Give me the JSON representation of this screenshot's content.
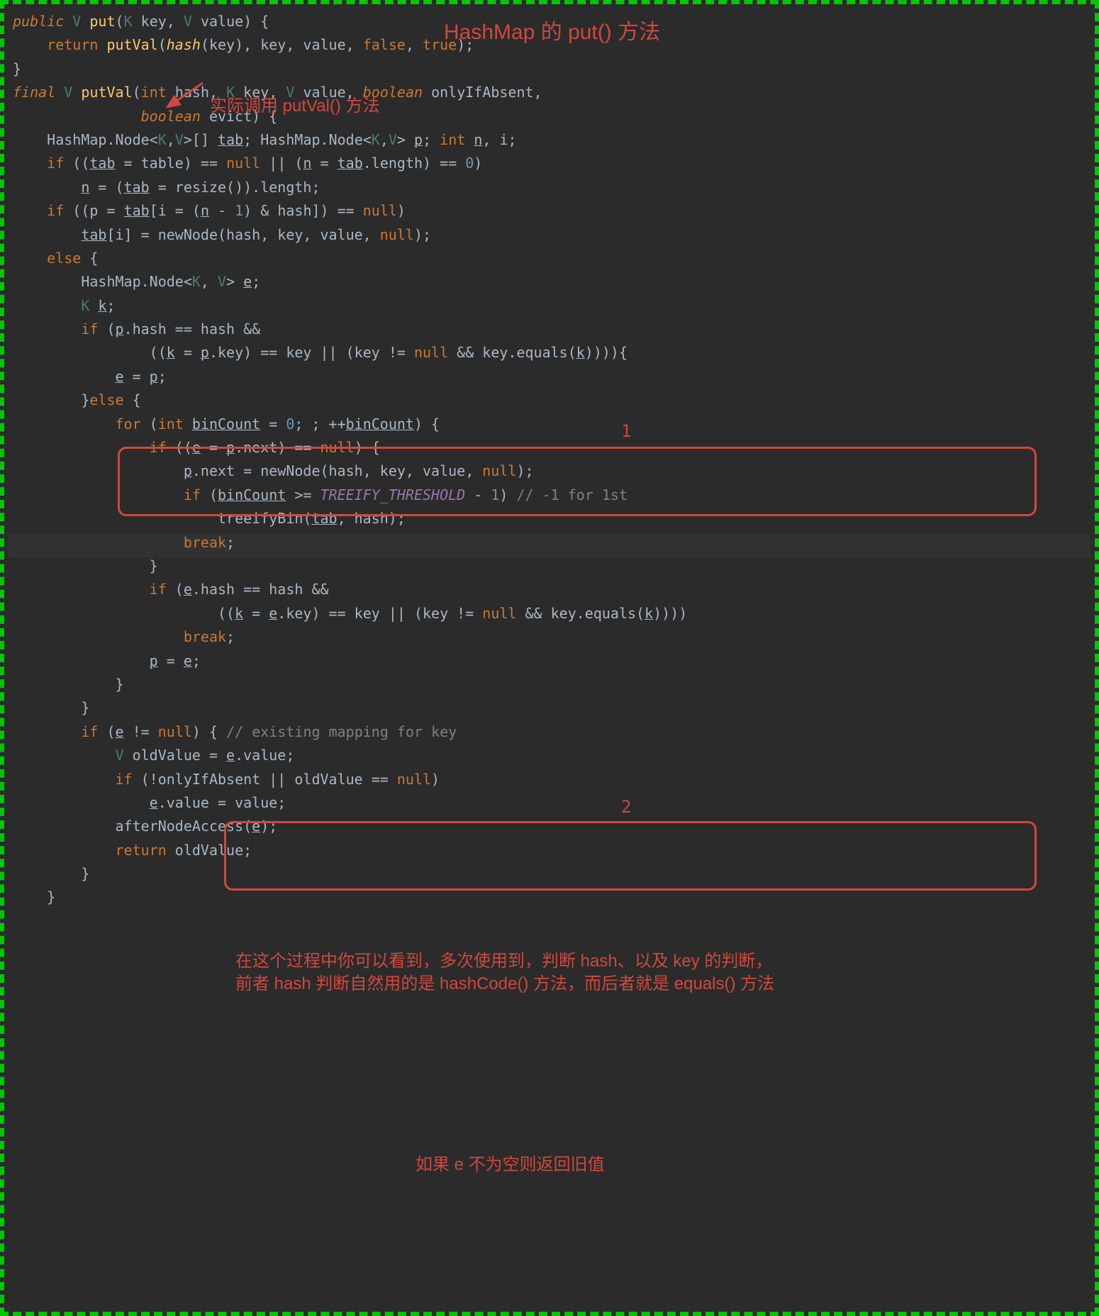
{
  "annotations": {
    "title": "HashMap 的 put() 方法",
    "calls": "实际调用 putVal() 方法",
    "box1_num": "1",
    "box2_num": "2",
    "summary_l1": "在这个过程中你可以看到，多次使用到，判断 hash、以及 key 的判断，",
    "summary_l2": "前者 hash 判断自然用的是 hashCode() 方法，而后者就是 equals() 方法",
    "old_value_note": "如果 e 不为空则返回旧值"
  },
  "code": {
    "l01_public": "public",
    "l01_V": "V",
    "l01_put": "put",
    "l01_K": "K",
    "l01_key": " key, ",
    "l01_Vp": "V",
    "l01_val": " value) {",
    "l02_return": "return",
    "l02_putVal": "putVal",
    "l02_hash": "hash",
    "l02_rest": "(key), key, value, ",
    "l02_false": "false",
    "l02_comma": ", ",
    "l02_true": "true",
    "l02_end": ");",
    "l03": "}",
    "l04_final": "final",
    "l04_V": "V",
    "l04_putVal": "putVal",
    "l04_int": "int",
    "l04_hash": " hash, ",
    "l04_K": "K",
    "l04_key": " key, ",
    "l04_Vp": "V",
    "l04_value": " value, ",
    "l04_boolean": "boolean",
    "l04_only": " onlyIfAbsent,",
    "l05_boolean": "boolean",
    "l05_evict": " evict) {",
    "l06_a": "HashMap.Node<",
    "l06_b": ",",
    "l06_c": ">[] ",
    "l06_tab": "tab",
    "l06_d": "; HashMap.Node<",
    "l06_e": ",",
    "l06_f": "> ",
    "l06_p": "p",
    "l06_g": "; ",
    "l06_int": "int",
    "l06_h": " ",
    "l06_n": "n",
    "l06_i": ", i;",
    "l07_if": "if",
    "l07_a": " ((",
    "l07_tab": "tab",
    "l07_b": " = table) == ",
    "l07_null": "null",
    "l07_c": " || (",
    "l07_n": "n",
    "l07_d": " = ",
    "l07_tab2": "tab",
    "l07_e": ".length) == ",
    "l07_zero": "0",
    "l07_f": ")",
    "l08_n": "n",
    "l08_a": " = (",
    "l08_tab": "tab",
    "l08_b": " = resize()).length;",
    "l09_if": "if",
    "l09_a": " ((p = ",
    "l09_tab": "tab",
    "l09_b": "[i = (",
    "l09_n": "n",
    "l09_c": " - ",
    "l09_one": "1",
    "l09_d": ") & hash]) == ",
    "l09_null": "null",
    "l09_e": ")",
    "l10_tab": "tab",
    "l10_a": "[i] = newNode(hash, key, value, ",
    "l10_null": "null",
    "l10_b": ");",
    "l11_else": "else",
    "l11_a": " {",
    "l12_a": "HashMap.Node<",
    "l12_K": "K",
    "l12_b": ", ",
    "l12_V": "V",
    "l12_c": "> ",
    "l12_e": "e",
    "l12_d": ";",
    "l13_K": "K",
    "l13_sp": " ",
    "l13_k": "k",
    "l13_a": ";",
    "l14_if": "if",
    "l14_a": " (",
    "l14_p": "p",
    "l14_b": ".hash == hash &&",
    "l15_a": "((",
    "l15_k": "k",
    "l15_b": " = ",
    "l15_p": "p",
    "l15_c": ".key) == key || (key != ",
    "l15_null": "null",
    "l15_d": " && key.equals(",
    "l15_k2": "k",
    "l15_e": ")))){",
    "l16_e": "e",
    "l16_a": " = ",
    "l16_p": "p",
    "l16_b": ";",
    "l17": "}",
    "l17_else": "else",
    "l17_a": " {",
    "l18_for": "for",
    "l18_a": " (",
    "l18_int": "int",
    "l18_b": " ",
    "l18_bc": "binCount",
    "l18_c": " = ",
    "l18_zero": "0",
    "l18_d": "; ; ++",
    "l18_bc2": "binCount",
    "l18_e": ") {",
    "l19_if": "if",
    "l19_a": " ((",
    "l19_e": "e",
    "l19_b": " = ",
    "l19_p": "p",
    "l19_c": ".next) == ",
    "l19_null": "null",
    "l19_d": ") {",
    "l20_p": "p",
    "l20_a": ".next = newNode(hash, key, value, ",
    "l20_null": "null",
    "l20_b": ");",
    "l21_if": "if",
    "l21_a": " (",
    "l21_bc": "binCount",
    "l21_b": " >= ",
    "l21_th": "TREEIFY_THRESHOLD",
    "l21_c": " - ",
    "l21_one": "1",
    "l21_d": ") ",
    "l21_cmt": "// -1 for 1st",
    "l22_a": "treeifyBin(",
    "l22_tab": "tab",
    "l22_b": ", hash);",
    "l23_break": "break",
    "l23_a": ";",
    "l24": "}",
    "l25_if": "if",
    "l25_a": " (",
    "l25_e": "e",
    "l25_b": ".hash == hash &&",
    "l26_a": "((",
    "l26_k": "k",
    "l26_b": " = ",
    "l26_e": "e",
    "l26_c": ".key) == key || (key != ",
    "l26_null": "null",
    "l26_d": " && key.equals(",
    "l26_k2": "k",
    "l26_e2": "))))",
    "l27_break": "break",
    "l27_a": ";",
    "l28_p": "p",
    "l28_a": " = ",
    "l28_e": "e",
    "l28_b": ";",
    "l29": "}",
    "l30": "}",
    "l31_if": "if",
    "l31_a": " (",
    "l31_e": "e",
    "l31_b": " != ",
    "l31_null": "null",
    "l31_c": ") { ",
    "l31_cmt": "// existing mapping for key",
    "l32_V": "V",
    "l32_a": " oldValue = ",
    "l32_e": "e",
    "l32_b": ".value;",
    "l33_if": "if",
    "l33_a": " (!onlyIfAbsent || oldValue == ",
    "l33_null": "null",
    "l33_b": ")",
    "l34_e": "e",
    "l34_a": ".value = value;",
    "l35_a": "afterNodeAccess(",
    "l35_e": "e",
    "l35_b": ");",
    "l36_return": "return",
    "l36_a": " oldValue;",
    "l37": "}",
    "l38": "}"
  }
}
